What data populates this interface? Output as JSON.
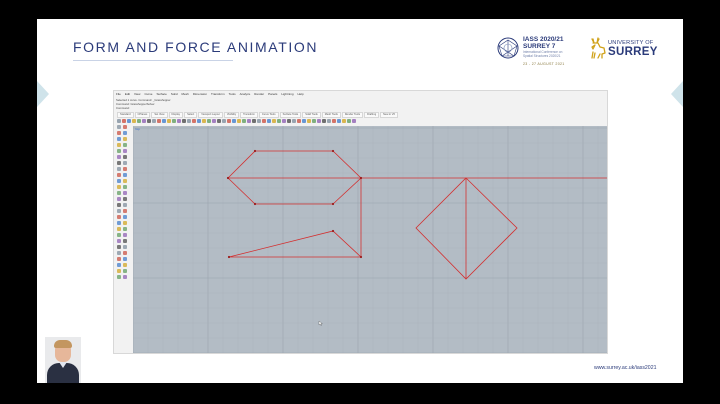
{
  "slide": {
    "title": "FORM AND FORCE ANIMATION",
    "footer_url": "www.surrey.ac.uk/iass2021"
  },
  "logos": {
    "iass": {
      "title_line1": "IASS 2020/21",
      "title_line2": "SURREY 7",
      "subtitle_line1": "International Conference on",
      "subtitle_line2": "Spatial Structures 2020/21",
      "dates": "23 - 27 AUGUST 2021"
    },
    "surrey": {
      "line1": "UNIVERSITY OF",
      "line2": "SURREY"
    }
  },
  "app": {
    "menu_items": [
      "File",
      "Edit",
      "View",
      "Curve",
      "Surface",
      "Solid",
      "Mesh",
      "Dimension",
      "Transform",
      "Tools",
      "Analyze",
      "Render",
      "Panels",
      "Lightning",
      "Help"
    ],
    "command_line_1": "Selected 1 curve. Command: _Grasshopper",
    "command_line_2": "Command: GrasshopperSolver",
    "command_prompt": "Command:",
    "tabs": [
      "Standard",
      "CPlanes",
      "Set View",
      "Display",
      "Select",
      "Viewport Layout",
      "Visibility",
      "Transform",
      "Curve Tools",
      "Surface Tools",
      "Solid Tools",
      "Mesh Tools",
      "Render Tools",
      "Drafting",
      "New in V6"
    ],
    "viewport_label": "Top",
    "colors": {
      "curve": "#d32f2f",
      "viewport_bg": "#b3bcc5",
      "grid_major": "#9aa4ae",
      "grid_minor": "#a7b0b9"
    }
  },
  "colors": {
    "title": "#2b3b7a",
    "accent_nav": "#cfe3ea",
    "background": "#ffffff"
  }
}
